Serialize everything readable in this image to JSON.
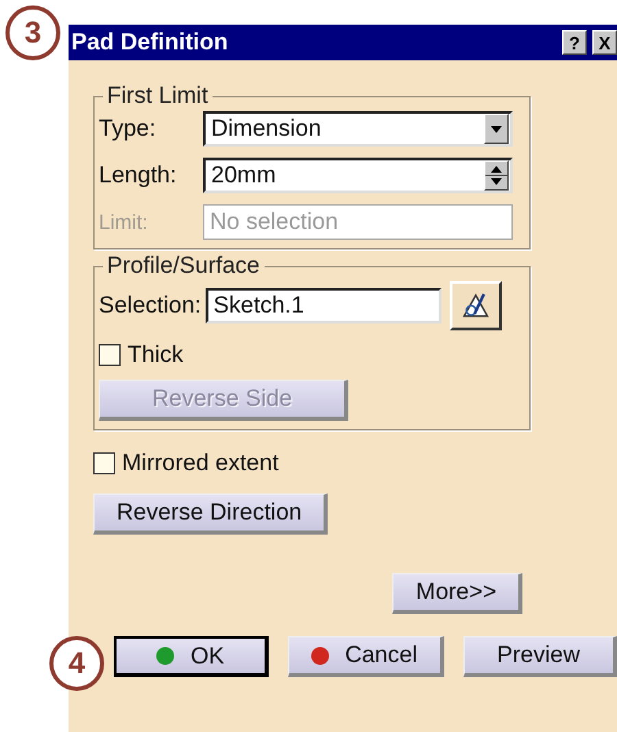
{
  "callouts": [
    {
      "number": "3"
    },
    {
      "number": "4"
    }
  ],
  "window": {
    "title": "Pad Definition",
    "title_buttons": [
      "?",
      "X"
    ]
  },
  "first_limit": {
    "title": "First Limit",
    "fields": [
      {
        "label": "Type:",
        "kind": "dropdown",
        "value": "Dimension",
        "disabled": false
      },
      {
        "label": "Length:",
        "kind": "spinner",
        "value": "20mm",
        "disabled": false
      },
      {
        "label": "Limit:",
        "kind": "text",
        "value": "No selection",
        "disabled": true
      }
    ]
  },
  "profile_surface": {
    "title": "Profile/Surface",
    "selection": {
      "label": "Selection:",
      "value": "Sketch.1"
    },
    "thick": {
      "label": "Thick",
      "checked": false
    },
    "reverse_side": {
      "label": "Reverse Side",
      "disabled": true
    }
  },
  "mirrored_extent": {
    "label": "Mirrored extent",
    "checked": false
  },
  "reverse_direction": {
    "label": "Reverse Direction",
    "disabled": false
  },
  "more_button": {
    "label": "More>>"
  },
  "buttons": [
    {
      "label": "OK",
      "color": "#1f9a2c",
      "default": true
    },
    {
      "label": "Cancel",
      "color": "#d0281e",
      "default": false
    },
    {
      "label": "Preview",
      "default": false
    }
  ]
}
